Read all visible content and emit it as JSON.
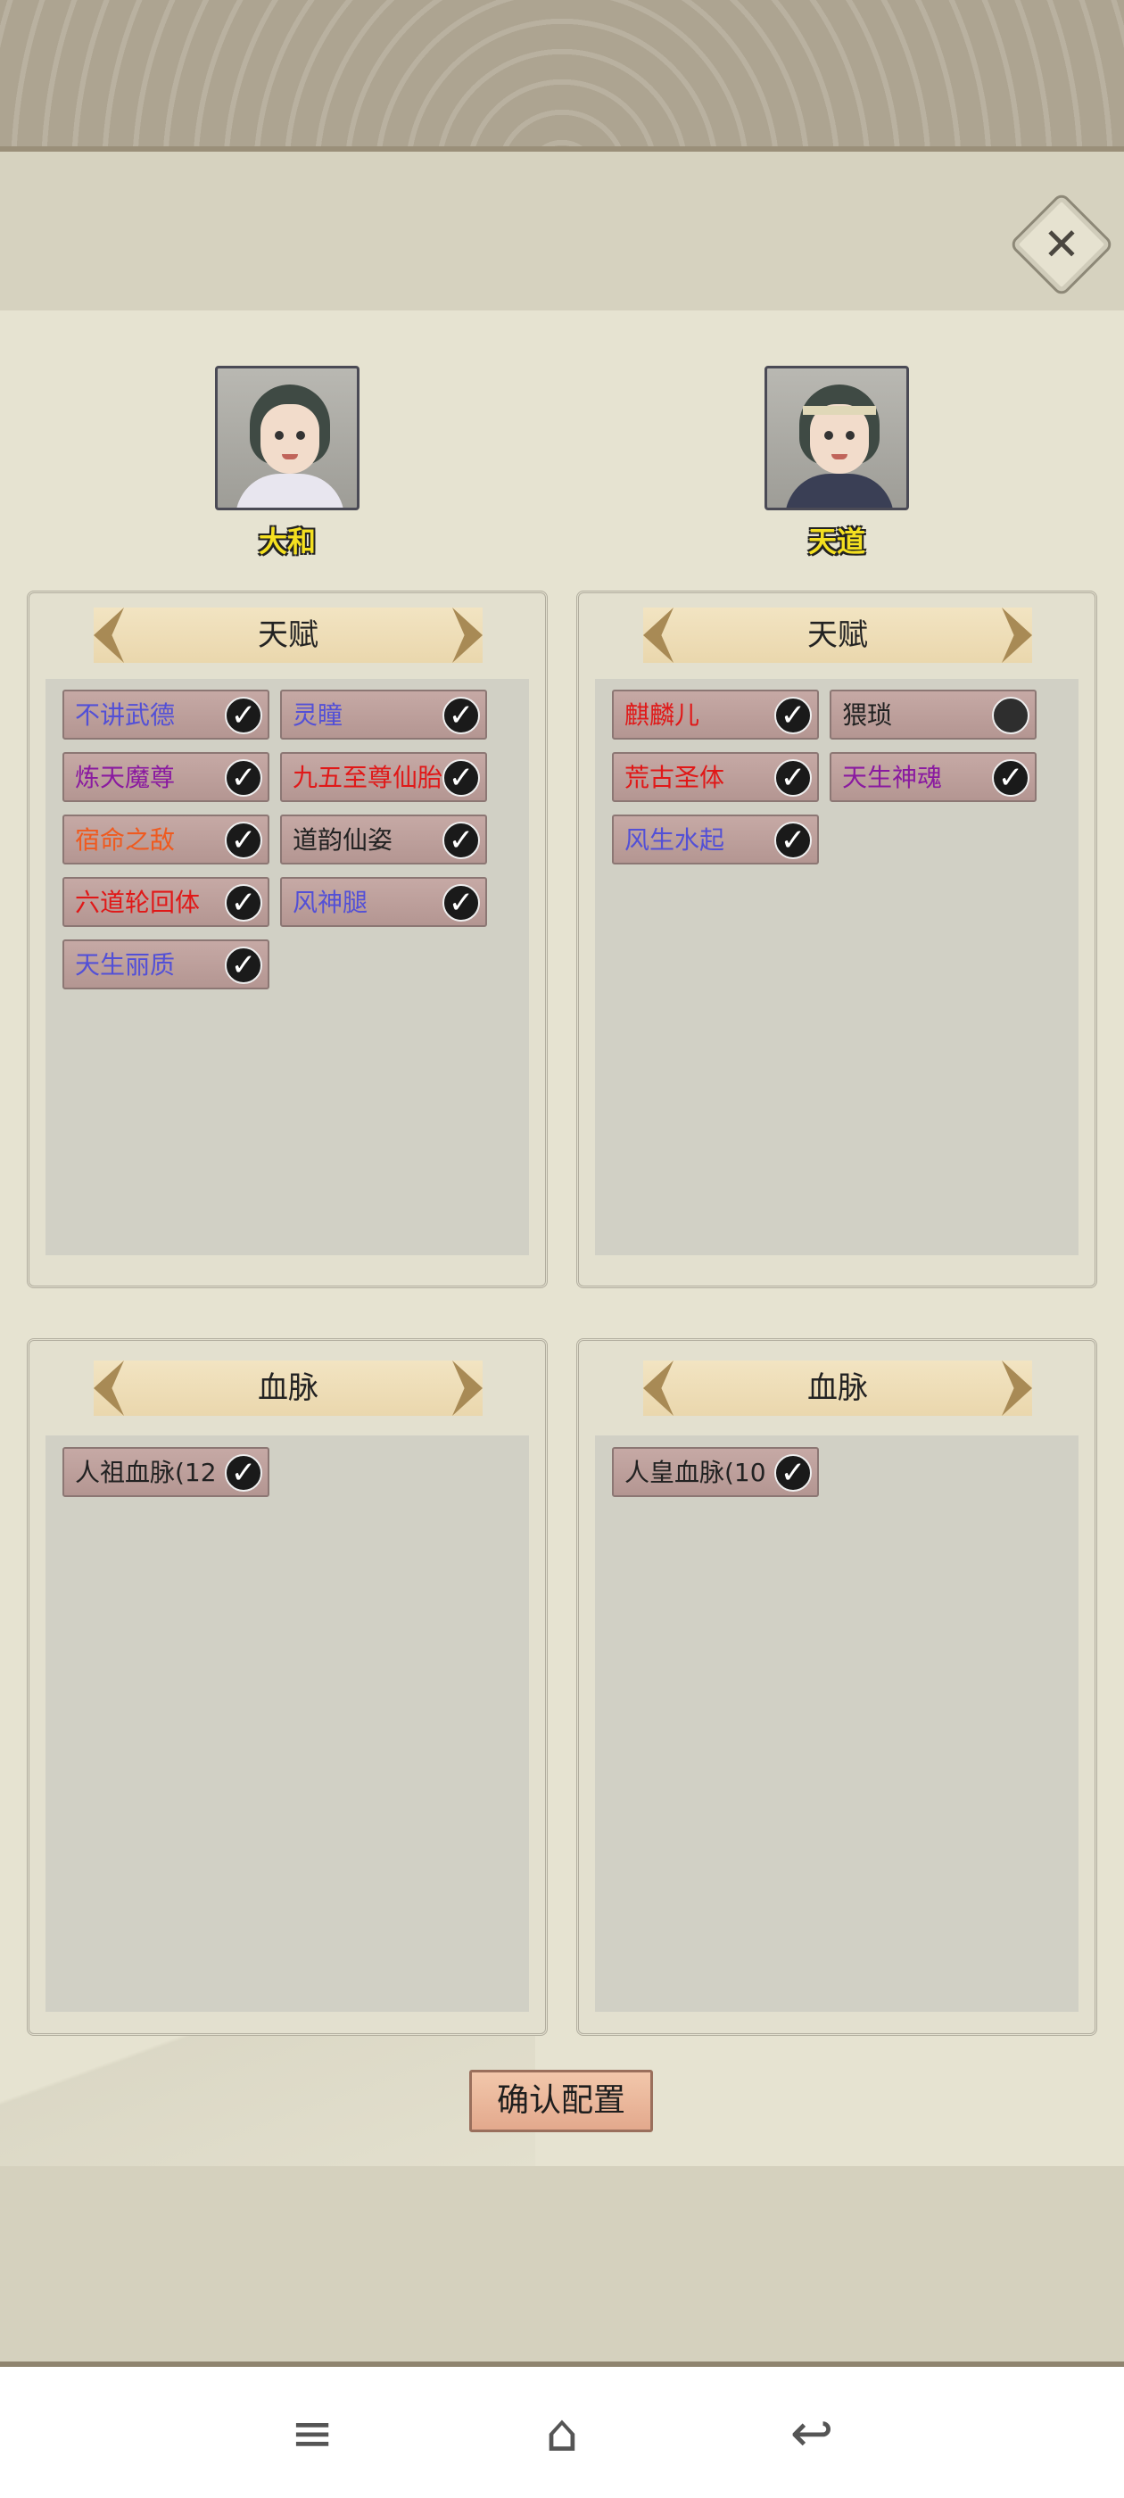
{
  "colors": {
    "blue": "#5350d6",
    "red": "#e01818",
    "purple": "#8a1aa0",
    "orange": "#ef5a1f",
    "black": "#222222"
  },
  "characters": [
    {
      "name": "大和"
    },
    {
      "name": "天道"
    }
  ],
  "talent": {
    "title": "天赋",
    "left": [
      {
        "label": "不讲武德",
        "color": "blue",
        "checked": true
      },
      {
        "label": "灵瞳",
        "color": "blue",
        "checked": true
      },
      {
        "label": "炼天魔尊",
        "color": "purple",
        "checked": true
      },
      {
        "label": "九五至尊仙胎",
        "color": "red",
        "checked": true
      },
      {
        "label": "宿命之敌",
        "color": "orange",
        "checked": true
      },
      {
        "label": "道韵仙姿",
        "color": "black",
        "checked": true
      },
      {
        "label": "六道轮回体",
        "color": "red",
        "checked": true
      },
      {
        "label": "风神腿",
        "color": "blue",
        "checked": true
      },
      {
        "label": "天生丽质",
        "color": "blue",
        "checked": true
      }
    ],
    "right": [
      {
        "label": "麒麟儿",
        "color": "red",
        "checked": true
      },
      {
        "label": "猥琐",
        "color": "black",
        "checked": false
      },
      {
        "label": "荒古圣体",
        "color": "red",
        "checked": true
      },
      {
        "label": "天生神魂",
        "color": "purple",
        "checked": true
      },
      {
        "label": "风生水起",
        "color": "blue",
        "checked": true
      }
    ]
  },
  "bloodline": {
    "title": "血脉",
    "left": [
      {
        "label": "人祖血脉(12",
        "color": "black",
        "checked": true
      }
    ],
    "right": [
      {
        "label": "人皇血脉(10",
        "color": "black",
        "checked": true
      }
    ]
  },
  "confirm_label": "确认配置",
  "close_symbol": "✕",
  "nav": {
    "menu": "≡",
    "home": "⌂",
    "back": "↩"
  }
}
